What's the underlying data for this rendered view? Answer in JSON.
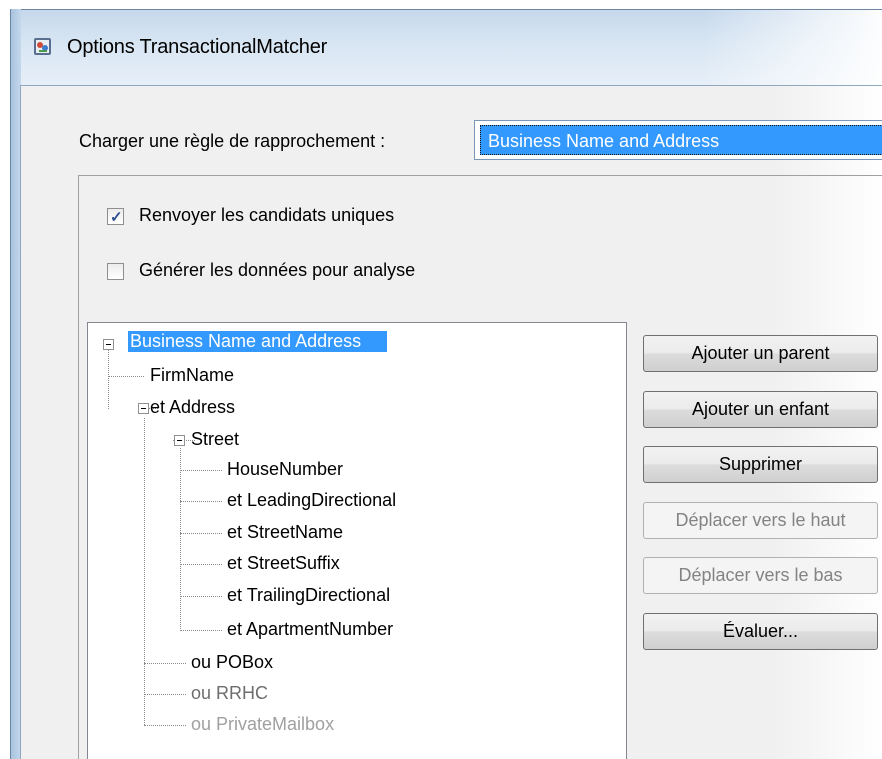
{
  "window": {
    "title": "Options TransactionalMatcher"
  },
  "load_rule": {
    "label": "Charger une règle de rapprochement :",
    "selected": "Business Name and Address"
  },
  "checkboxes": [
    {
      "label": "Renvoyer les candidats uniques",
      "checked": true
    },
    {
      "label": "Générer les données pour analyse",
      "checked": false
    }
  ],
  "tree": {
    "root": "Business Name and Address",
    "nodes": {
      "firm_name": "FirmName",
      "address": "et Address",
      "street": "Street",
      "house_number": "HouseNumber",
      "leading_directional": "et LeadingDirectional",
      "street_name": "et StreetName",
      "street_suffix": "et StreetSuffix",
      "trailing_directional": "et TrailingDirectional",
      "apartment_number": "et ApartmentNumber",
      "po_box": "ou POBox",
      "rrhc": "ou RRHC",
      "private_mailbox": "ou PrivateMailbox"
    }
  },
  "buttons": {
    "add_parent": "Ajouter un parent",
    "add_child": "Ajouter un enfant",
    "delete": "Supprimer",
    "move_up": "Déplacer vers le haut",
    "move_down": "Déplacer vers le bas",
    "evaluate": "Évaluer..."
  },
  "colors": {
    "selection": "#3399ff",
    "disabled_text": "#838383"
  }
}
